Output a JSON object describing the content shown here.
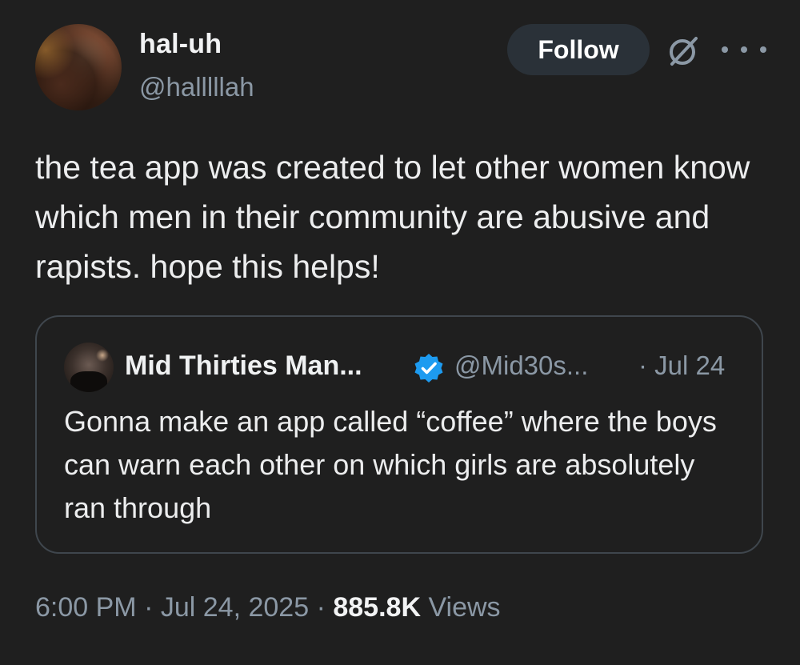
{
  "author": {
    "display_name": "hal-uh",
    "handle": "@halllllah"
  },
  "actions": {
    "follow_label": "Follow",
    "grok_icon": "grok-icon",
    "more_icon": "more-icon"
  },
  "tweet": {
    "text": "the tea app was created to let other women know which men in their community are abusive and rapists. hope this helps!"
  },
  "quoted": {
    "display_name": "Mid Thirties Man...",
    "handle": "@Mid30s...",
    "date": "· Jul 24",
    "text": "Gonna make an app called “coffee” where the boys can warn each other on which girls are absolutely ran through",
    "verified_color": "#1d9bf0"
  },
  "meta": {
    "time": "6:00 PM",
    "sep1": "·",
    "date": "Jul 24, 2025",
    "sep2": "·",
    "views_count": "885.8K",
    "views_label": "Views"
  },
  "colors": {
    "background": "#1f1f1f",
    "secondary_text": "#8b98a5",
    "primary_text": "#ecedee",
    "border": "#3f464d",
    "follow_button_bg": "#2a3138"
  }
}
